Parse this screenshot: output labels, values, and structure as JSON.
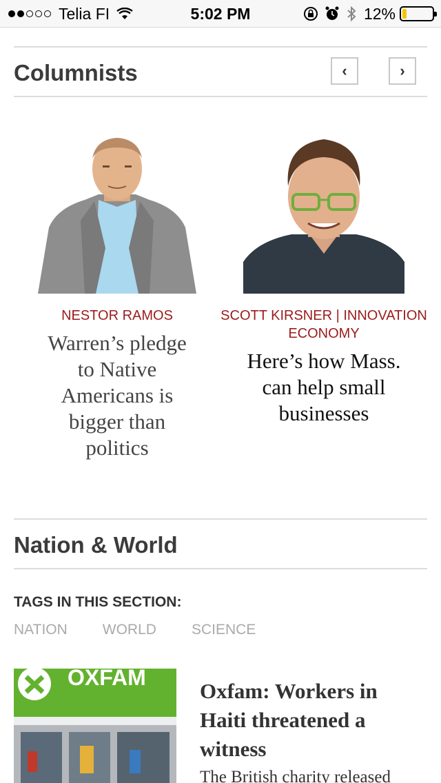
{
  "status_bar": {
    "carrier": "Telia FI",
    "time": "5:02 PM",
    "battery": "12%",
    "icons": [
      "signal-dots-icon",
      "wifi-icon",
      "rotation-lock-icon",
      "alarm-icon",
      "bluetooth-icon",
      "battery-icon"
    ]
  },
  "columnists": {
    "title": "Columnists",
    "prev_icon": "‹",
    "next_icon": "›",
    "items": [
      {
        "author": "NESTOR RAMOS",
        "headline": "Warren’s pledge to Native Americans is bigger than politics"
      },
      {
        "author": "SCOTT KIRSNER | INNOVATION ECONOMY",
        "headline": "Here’s how Mass. can help small businesses"
      }
    ]
  },
  "nation_world": {
    "title": "Nation & World",
    "tags_heading": "TAGS IN THIS SECTION:",
    "tags": [
      "NATION",
      "WORLD",
      "SCIENCE"
    ],
    "story": {
      "image_text": "OXFAM",
      "headline": "Oxfam: Workers in Haiti threatened a witness",
      "summary": "The British charity released"
    }
  },
  "colors": {
    "author": "#9b1b1b",
    "oxfam_green": "#63b22f",
    "battery_fill": "#f5c400"
  }
}
